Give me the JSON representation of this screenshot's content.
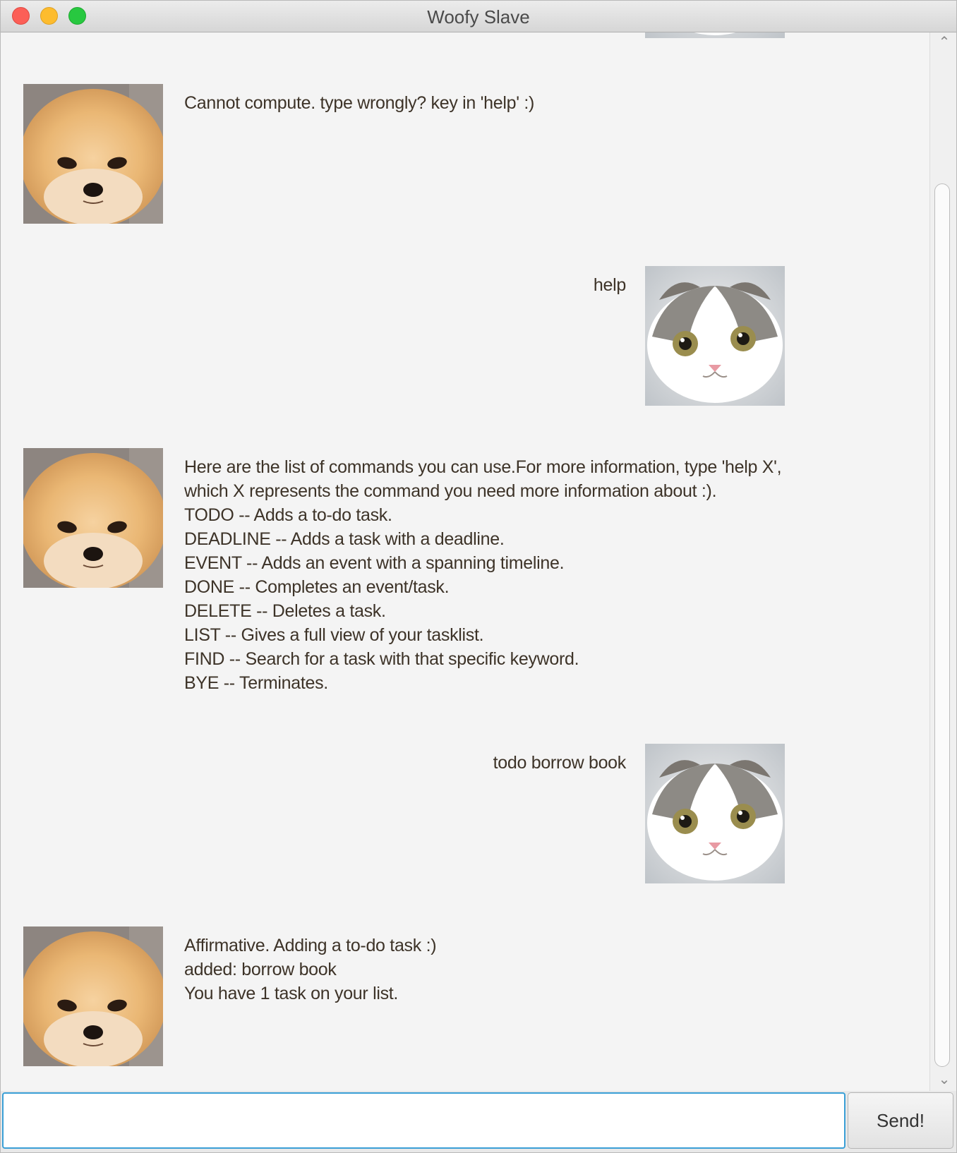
{
  "window": {
    "title": "Woofy Slave"
  },
  "messages": [
    {
      "sender": "bot",
      "avatar": "pomeranian-avatar",
      "text": "Cannot compute. type wrongly? key in 'help' :)"
    },
    {
      "sender": "user",
      "avatar": "cat-avatar",
      "text": "help"
    },
    {
      "sender": "bot",
      "avatar": "pomeranian-avatar",
      "text": "Here are the list of commands you can use.For more information, type 'help X',\nwhich X represents the command you need more information about :).\n TODO -- Adds a to-do task.\nDEADLINE -- Adds a task with a deadline.\nEVENT -- Adds an event with a spanning timeline.\nDONE -- Completes an event/task.\nDELETE -- Deletes a task.\nLIST -- Gives a full view of your tasklist.\nFIND -- Search for a task with that specific keyword.\nBYE -- Terminates."
    },
    {
      "sender": "user",
      "avatar": "cat-avatar",
      "text": "todo borrow book"
    },
    {
      "sender": "bot",
      "avatar": "pomeranian-avatar",
      "text": "Affirmative. Adding a to-do task :)\nadded: borrow book\nYou have 1 task on your list."
    }
  ],
  "input": {
    "value": "",
    "placeholder": ""
  },
  "send_button": {
    "label": "Send!"
  },
  "colors": {
    "background": "#f4f4f4",
    "text": "#3d3328",
    "input_focus": "#3a9fd6"
  }
}
